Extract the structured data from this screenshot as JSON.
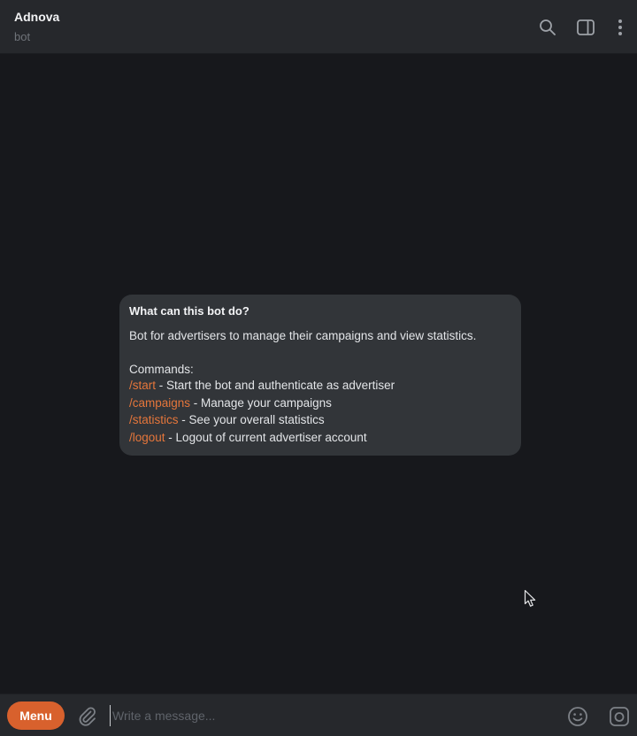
{
  "header": {
    "title": "Adnova",
    "subtitle": "bot",
    "icons": [
      "search-icon",
      "sidebar-icon",
      "more-vertical-icon"
    ]
  },
  "intro": {
    "title": "What can this bot do?",
    "description": "Bot for advertisers to manage their campaigns and view statistics.",
    "commands_heading": "Commands:",
    "commands": [
      {
        "command": "/start",
        "separator": " - ",
        "description": "Start the bot and authenticate as advertiser"
      },
      {
        "command": "/campaigns",
        "separator": " - ",
        "description": "Manage your campaigns"
      },
      {
        "command": "/statistics",
        "separator": " - ",
        "description": "See your overall statistics"
      },
      {
        "command": "/logout",
        "separator": " - ",
        "description": "Logout of current advertiser account"
      }
    ]
  },
  "composer": {
    "menu_label": "Menu",
    "placeholder": "Write a message...",
    "value": "",
    "icons": [
      "attach-icon",
      "emoji-icon",
      "camera-icon"
    ]
  },
  "colors": {
    "accent": "#d8612d",
    "command_link": "#e5763b",
    "header_bg": "#26282c",
    "chat_bg": "#17181c",
    "card_bg": "#323539"
  }
}
